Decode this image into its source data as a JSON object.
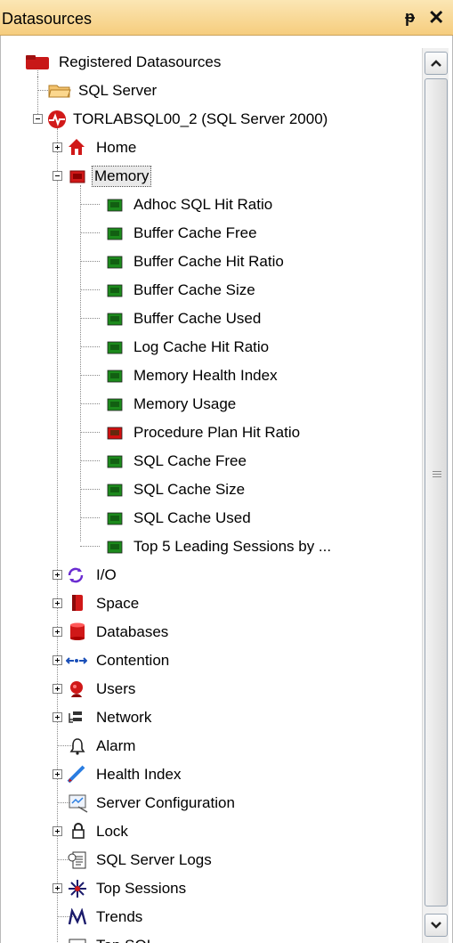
{
  "panel": {
    "title": "Datasources",
    "pin": "ᵽ",
    "close": "✕"
  },
  "tree": {
    "root": "Registered Datasources",
    "sql_server": "SQL Server",
    "server": "TORLABSQL00_2 (SQL Server 2000)",
    "home": "Home",
    "memory": "Memory",
    "memory_items": [
      "Adhoc SQL Hit Ratio",
      "Buffer Cache Free",
      "Buffer Cache Hit Ratio",
      "Buffer Cache Size",
      "Buffer Cache Used",
      "Log Cache Hit Ratio",
      "Memory Health Index",
      "Memory Usage",
      "Procedure Plan Hit Ratio",
      "SQL Cache Free",
      "SQL Cache Size",
      "SQL Cache Used",
      "Top 5 Leading Sessions by ..."
    ],
    "memory_item_status": [
      "ok",
      "ok",
      "ok",
      "ok",
      "ok",
      "ok",
      "ok",
      "ok",
      "alert",
      "ok",
      "ok",
      "ok",
      "ok"
    ],
    "io": "I/O",
    "space": "Space",
    "databases": "Databases",
    "contention": "Contention",
    "users": "Users",
    "network": "Network",
    "alarm": "Alarm",
    "health_index": "Health Index",
    "server_config": "Server Configuration",
    "lock": "Lock",
    "sql_server_logs": "SQL Server Logs",
    "top_sessions": "Top Sessions",
    "trends": "Trends",
    "top_sql": "Top SQL"
  },
  "colors": {
    "ok": "#1c8a1c",
    "alert": "#d01010",
    "accent": "#f6cd7e"
  }
}
